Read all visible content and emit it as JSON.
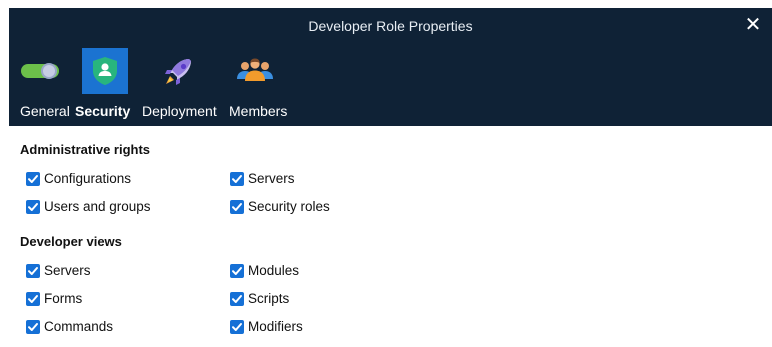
{
  "dialog": {
    "title": "Developer Role Properties",
    "close_icon": "close-icon"
  },
  "tabs": [
    {
      "label": "General",
      "icon": "toggle-icon",
      "active": false
    },
    {
      "label": "Security",
      "icon": "shield-user-icon",
      "active": true
    },
    {
      "label": "Deployment",
      "icon": "rocket-icon",
      "active": false
    },
    {
      "label": "Members",
      "icon": "group-icon",
      "active": false
    }
  ],
  "sections": {
    "admin": {
      "title": "Administrative rights",
      "items": [
        {
          "label": "Configurations",
          "checked": true
        },
        {
          "label": "Servers",
          "checked": true
        },
        {
          "label": "Users and groups",
          "checked": true
        },
        {
          "label": "Security roles",
          "checked": true
        }
      ]
    },
    "dev": {
      "title": "Developer views",
      "items": [
        {
          "label": "Servers",
          "checked": true
        },
        {
          "label": "Modules",
          "checked": true
        },
        {
          "label": "Forms",
          "checked": true
        },
        {
          "label": "Scripts",
          "checked": true
        },
        {
          "label": "Commands",
          "checked": true
        },
        {
          "label": "Modifiers",
          "checked": true
        }
      ]
    }
  },
  "colors": {
    "header_bg": "#0f2236",
    "active_tab_bg": "#1b73d1",
    "checkbox": "#1570d6"
  }
}
